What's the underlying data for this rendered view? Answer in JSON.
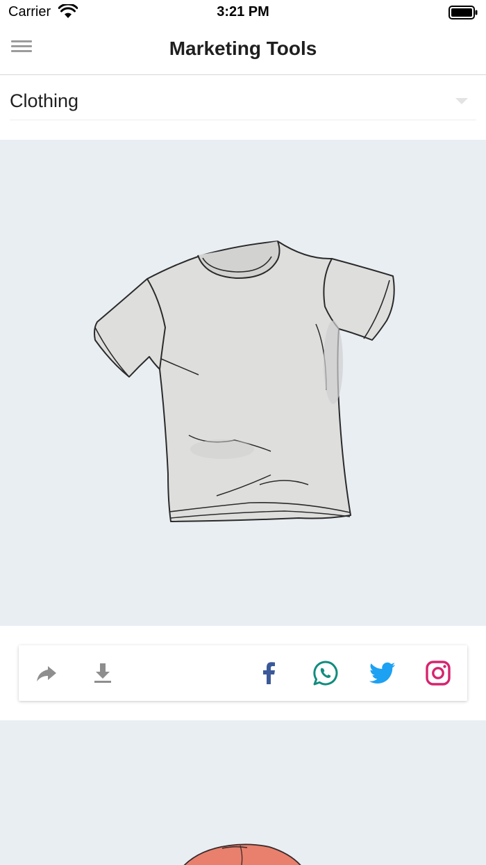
{
  "status_bar": {
    "carrier": "Carrier",
    "time": "3:21 PM"
  },
  "nav": {
    "title": "Marketing Tools",
    "menu_icon": "hamburger-menu-icon"
  },
  "category": {
    "selected": "Clothing",
    "icon": "dropdown-arrow-icon"
  },
  "products": [
    {
      "illustration": "t-shirt"
    },
    {
      "illustration": "red-cap"
    }
  ],
  "actions": {
    "left": [
      {
        "name": "share",
        "icon": "share-icon"
      },
      {
        "name": "download",
        "icon": "download-icon"
      }
    ],
    "social": [
      {
        "name": "facebook",
        "icon": "facebook-icon",
        "color": "#3b5998"
      },
      {
        "name": "whatsapp",
        "icon": "whatsapp-icon",
        "color": "#128c7e"
      },
      {
        "name": "twitter",
        "icon": "twitter-icon",
        "color": "#1da1f2"
      },
      {
        "name": "instagram",
        "icon": "instagram-icon",
        "color": "#d6246e"
      }
    ]
  },
  "colors": {
    "image_background": "#e9eef3",
    "icon_gray": "#8e8e8e"
  }
}
